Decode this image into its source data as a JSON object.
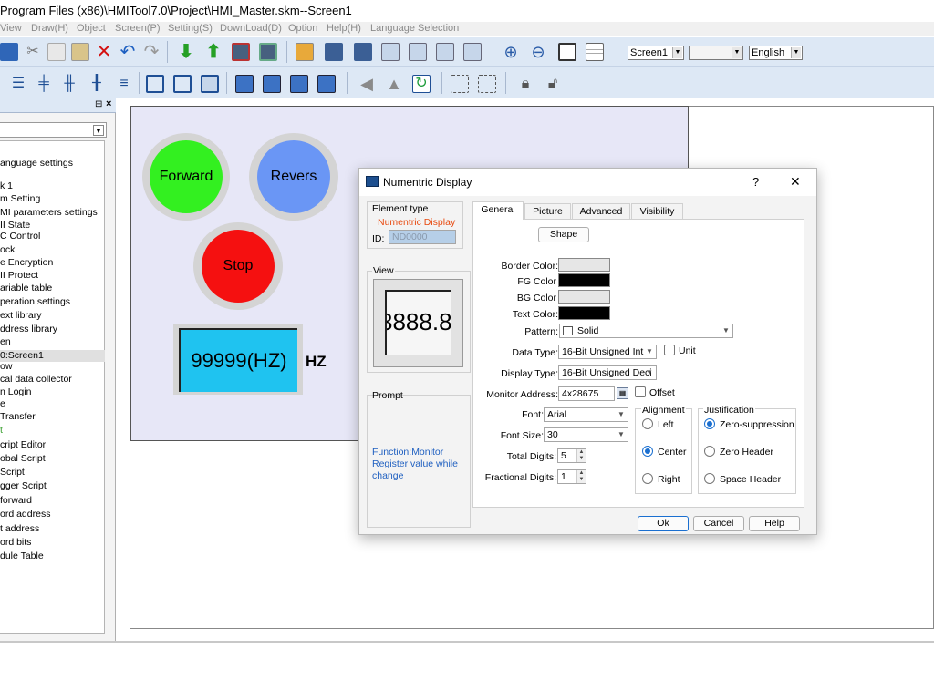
{
  "window": {
    "title": "Program Files (x86)\\HMITool7.0\\Project\\HMI_Master.skm--Screen1"
  },
  "menu": [
    {
      "label": "View"
    },
    {
      "label": "Draw(H)"
    },
    {
      "label": "Object"
    },
    {
      "label": "Screen(P)"
    },
    {
      "label": "Setting(S)"
    },
    {
      "label": "DownLoad(D)"
    },
    {
      "label": "Option"
    },
    {
      "label": "Help(H)"
    },
    {
      "label": "Language Selection"
    }
  ],
  "toolbar": {
    "screen_select": "Screen1",
    "blank_select": "",
    "language_select": "English"
  },
  "panel": {
    "close_glyph": "×",
    "pin_glyph": "⊟",
    "items": [
      {
        "label": "anguage settings"
      },
      {
        "label": "k 1"
      },
      {
        "label": "m Setting"
      },
      {
        "label": "MI parameters settings"
      },
      {
        "label": "II State"
      },
      {
        "label": "C Control"
      },
      {
        "label": "ock"
      },
      {
        "label": "e Encryption"
      },
      {
        "label": "II Protect"
      },
      {
        "label": "ariable table"
      },
      {
        "label": "peration settings"
      },
      {
        "label": "ext library"
      },
      {
        "label": "ddress library"
      },
      {
        "label": "en"
      },
      {
        "label": "0:Screen1"
      },
      {
        "label": "ow"
      },
      {
        "label": "cal data collector"
      },
      {
        "label": "n Login"
      },
      {
        "label": "e"
      },
      {
        "label": "Transfer"
      },
      {
        "label": "t"
      },
      {
        "label": "cript Editor"
      },
      {
        "label": "obal Script"
      },
      {
        "label": "Script"
      },
      {
        "label": "gger Script"
      },
      {
        "label": "forward"
      },
      {
        "label": "ord address"
      },
      {
        "label": "t address"
      },
      {
        "label": "ord bits"
      },
      {
        "label": "dule Table"
      }
    ]
  },
  "canvas": {
    "forward_label": "Forward",
    "revers_label": "Revers",
    "stop_label": "Stop",
    "display_value": "99999(HZ)",
    "hz_label": "HZ",
    "colors": {
      "forward": "#33f020",
      "revers": "#6a96f5",
      "stop": "#f51010",
      "display": "#1fc3f0"
    }
  },
  "dialog": {
    "title": "Numentric Display",
    "help_glyph": "?",
    "close_glyph": "✕",
    "element_type_label": "Element type",
    "element_type_value": "Numentric Display",
    "id_label": "ID:",
    "id_value": "ND0000",
    "view_label": "View",
    "view_preview": "3888.8",
    "prompt_label": "Prompt",
    "prompt_text": "Function:Monitor Register value while change",
    "tabs": [
      {
        "label": "General"
      },
      {
        "label": "Picture"
      },
      {
        "label": "Advanced"
      },
      {
        "label": "Visibility"
      }
    ],
    "shape_button": "Shape",
    "border_color_label": "Border Color:",
    "fg_color_label": "FG Color",
    "bg_color_label": "BG Color",
    "text_color_label": "Text Color:",
    "pattern_label": "Pattern:",
    "pattern_value": "Solid",
    "data_type_label": "Data Type:",
    "data_type_value": "16-Bit Unsigned Int",
    "unit_label": "Unit",
    "display_type_label": "Display Type:",
    "display_type_value": "16-Bit Unsigned Deci",
    "monitor_address_label": "Monitor Address:",
    "monitor_address_value": "4x28675",
    "offset_label": "Offset",
    "font_label": "Font:",
    "font_value": "Arial",
    "font_size_label": "Font Size:",
    "font_size_value": "30",
    "total_digits_label": "Total Digits:",
    "total_digits_value": "5",
    "fractional_digits_label": "Fractional Digits:",
    "fractional_digits_value": "1",
    "alignment_label": "Alignment",
    "align_left": "Left",
    "align_center": "Center",
    "align_right": "Right",
    "alignment_selected": "Center",
    "justification_label": "Justification",
    "just_zero_supp": "Zero-suppression",
    "just_zero_header": "Zero Header",
    "just_space_header": "Space Header",
    "justification_selected": "Zero-suppression",
    "ok_button": "Ok",
    "cancel_button": "Cancel",
    "help_button": "Help",
    "colors": {
      "border": "#e6e6e6",
      "fg": "#000000",
      "bg": "#e6e6e6",
      "text": "#000000"
    }
  }
}
